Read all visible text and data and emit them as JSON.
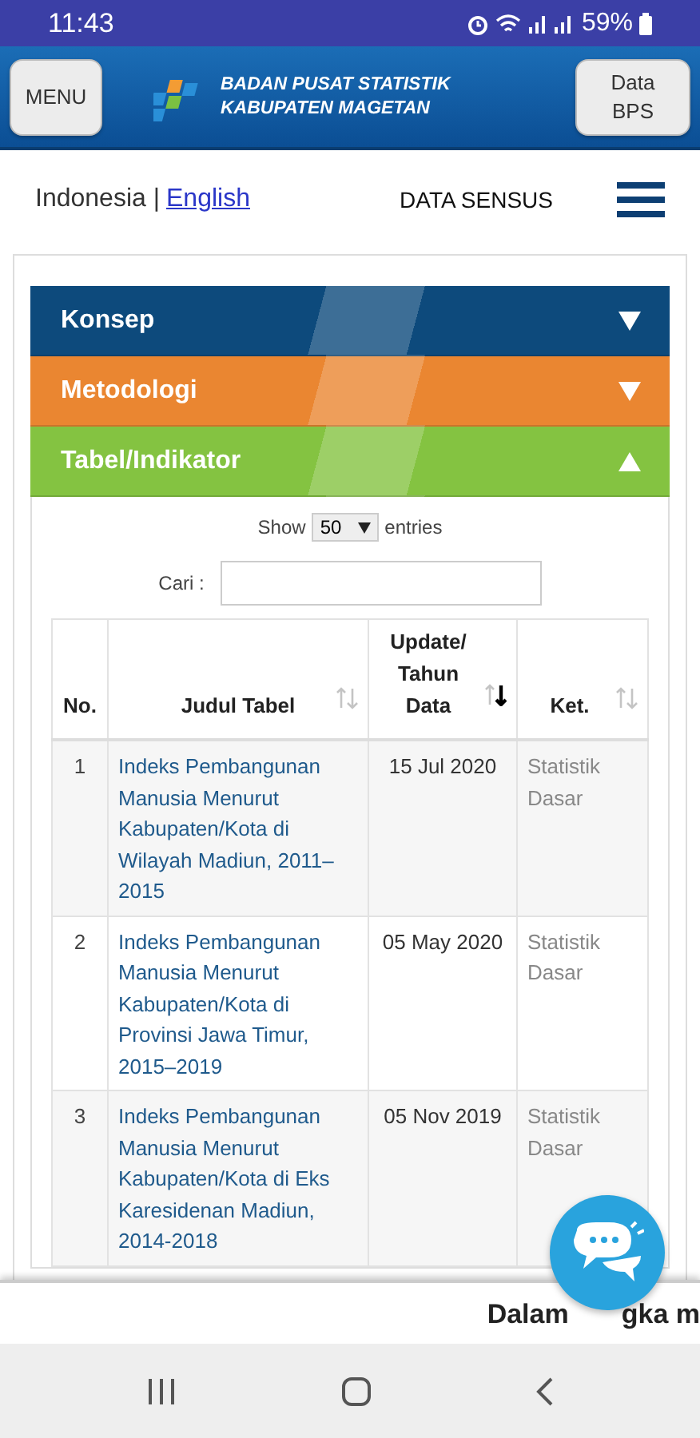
{
  "status_bar": {
    "time": "11:43",
    "battery": "59%"
  },
  "header": {
    "menu_button": "MENU",
    "logo_lines": [
      "BADAN PUSAT STATISTIK",
      "KABUPATEN MAGETAN"
    ],
    "data_button": [
      "Data",
      "BPS"
    ]
  },
  "lang": {
    "current": "Indonesia |",
    "link": "English",
    "section": "DATA SENSUS"
  },
  "accordion": [
    {
      "label": "Konsep",
      "expanded": false,
      "color": "#0d4a7c"
    },
    {
      "label": "Metodologi",
      "expanded": false,
      "color": "#ea8631"
    },
    {
      "label": "Tabel/Indikator",
      "expanded": true,
      "color": "#84c341"
    }
  ],
  "length": {
    "before": "Show",
    "value": "50",
    "after": "entries"
  },
  "search": {
    "label": "Cari :"
  },
  "table": {
    "columns": [
      {
        "label": "No.",
        "sortable": false,
        "sorted": false
      },
      {
        "label": "Judul Tabel",
        "sortable": true,
        "sorted": false
      },
      {
        "label": "Update/ Tahun Data",
        "sortable": true,
        "sorted": true
      },
      {
        "label": "Ket.",
        "sortable": true,
        "sorted": false
      }
    ],
    "rows": [
      [
        "1",
        "Indeks Pembangunan Manusia Menurut Kabupaten/Kota di Wilayah Madiun, 2011–2015",
        "15 Jul 2020",
        "Statistik Dasar"
      ],
      [
        "2",
        "Indeks Pembangunan Manusia Menurut Kabupaten/Kota di Provinsi Jawa Timur, 2015–2019",
        "05 May 2020",
        "Statistik Dasar"
      ],
      [
        "3",
        "Indeks Pembangunan Manusia Menurut Kabupaten/Kota di Eks Karesidenan Madiun, 2014-2018",
        "05 Nov 2019",
        "Statistik Dasar"
      ]
    ]
  },
  "ticker": [
    "Dalam",
    "gka m"
  ]
}
